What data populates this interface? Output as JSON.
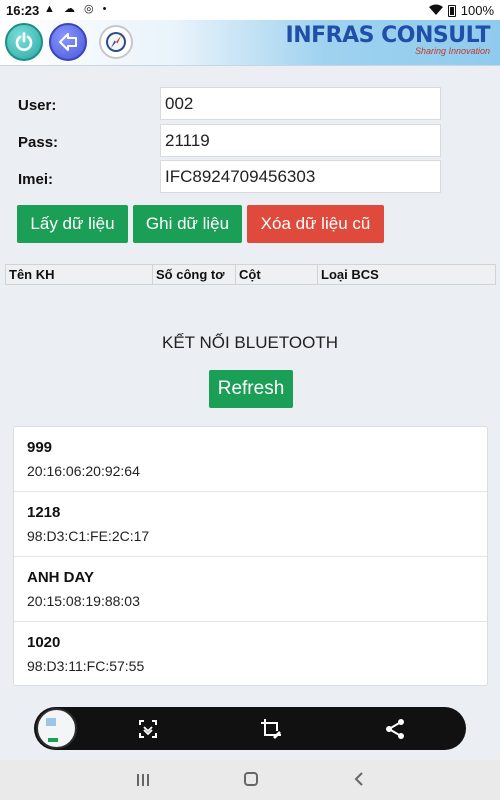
{
  "status_bar": {
    "time": "16:23",
    "left_icons": "▲ ☁ ◎ •",
    "battery": "100%"
  },
  "header": {
    "brand_name": "INFRAS CONSULT",
    "brand_tagline": "Sharing Innovation"
  },
  "form": {
    "user_label": "User:",
    "user_value": "002",
    "pass_label": "Pass:",
    "pass_value": "21119",
    "imei_label": "Imei:",
    "imei_value": "IFC8924709456303"
  },
  "actions": {
    "get_data": "Lấy dữ liệu",
    "write_data": "Ghi dữ liệu",
    "delete_old": "Xóa dữ liệu cũ"
  },
  "table": {
    "columns": [
      "Tên KH",
      "Số công tơ",
      "Cột",
      "Loại BCS"
    ]
  },
  "bluetooth": {
    "title": "KẾT NỐI BLUETOOTH",
    "refresh_label": "Refresh",
    "devices": [
      {
        "name": "999",
        "mac": "20:16:06:20:92:64"
      },
      {
        "name": "1218",
        "mac": "98:D3:C1:FE:2C:17"
      },
      {
        "name": "ANH DAY",
        "mac": "20:15:08:19:88:03"
      },
      {
        "name": "1020",
        "mac": "98:D3:11:FC:57:55"
      }
    ]
  },
  "colors": {
    "green": "#1b9e55",
    "red": "#e04a3c",
    "brand": "#1f4fa8"
  },
  "icons": [
    "power-icon",
    "back-arrow-icon",
    "compass-icon",
    "scroll-capture-icon",
    "crop-edit-icon",
    "share-icon"
  ]
}
